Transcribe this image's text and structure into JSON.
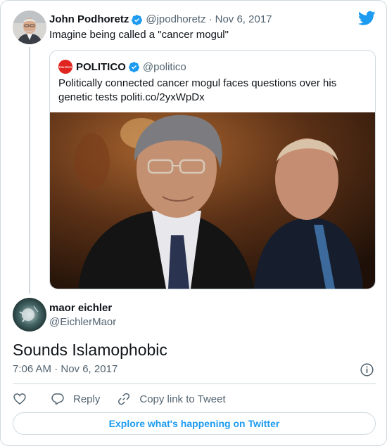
{
  "parent_tweet": {
    "author_name": "John Podhoretz",
    "handle": "@jpodhoretz",
    "separator": "·",
    "date": "Nov 6, 2017",
    "text": "Imagine being called a \"cancer mogul\""
  },
  "quoted_tweet": {
    "author_name": "POLITICO",
    "avatar_text": "POLITICO",
    "handle": "@politico",
    "text": "Politically connected cancer mogul faces questions over his genetic tests politi.co/2yxWpDx"
  },
  "reply_tweet": {
    "author_name": "maor eichler",
    "handle": "@EichlerMaor",
    "text": "Sounds Islamophobic",
    "timestamp": "7:06 AM · Nov 6, 2017"
  },
  "actions": {
    "reply_label": "Reply",
    "copy_link_label": "Copy link to Tweet"
  },
  "explore_label": "Explore what's happening on Twitter",
  "colors": {
    "accent": "#1d9bf0",
    "text_primary": "#0f1419",
    "text_secondary": "#536471",
    "border": "#cfd9de",
    "politico_red": "#e0241f"
  },
  "icons": [
    "verified-badge-icon",
    "twitter-bird-icon",
    "info-icon",
    "heart-icon",
    "reply-icon",
    "link-icon"
  ]
}
